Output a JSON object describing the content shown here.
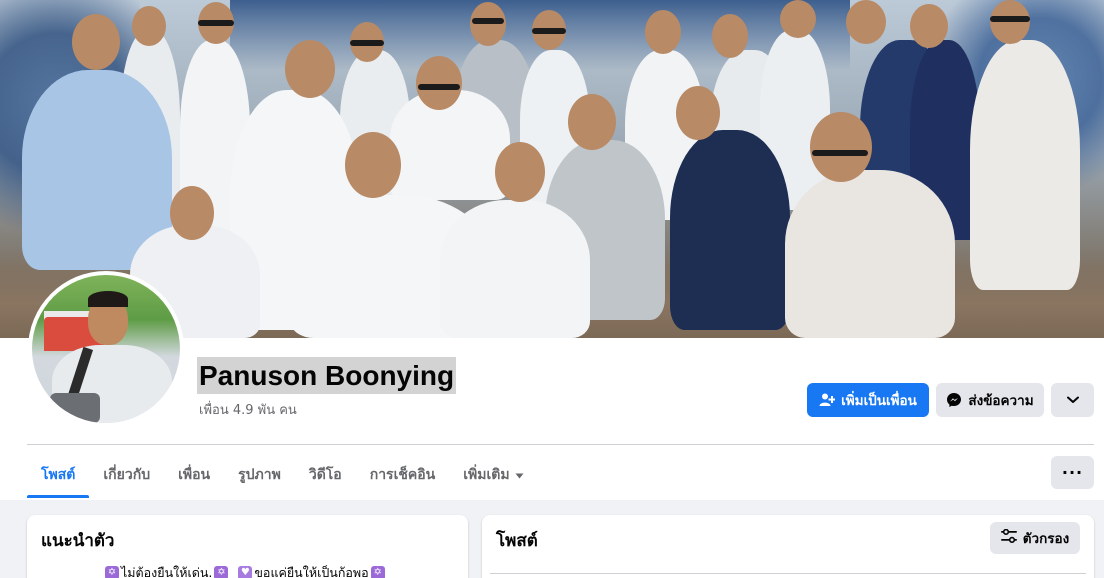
{
  "profile": {
    "name": "Panuson Boonying",
    "friends_count": "เพื่อน 4.9 พัน คน"
  },
  "actions": {
    "add_friend_label": "เพิ่มเป็นเพื่อน",
    "message_label": "ส่งข้อความ",
    "more_icon": "chevron-down-icon"
  },
  "tabs": [
    {
      "label": "โพสต์",
      "active": true
    },
    {
      "label": "เกี่ยวกับ",
      "active": false
    },
    {
      "label": "เพื่อน",
      "active": false
    },
    {
      "label": "รูปภาพ",
      "active": false
    },
    {
      "label": "วิดีโอ",
      "active": false
    },
    {
      "label": "การเช็คอิน",
      "active": false
    },
    {
      "label": "เพิ่มเติม",
      "active": false
    }
  ],
  "tab_overflow_label": "···",
  "intro": {
    "title": "แนะนำตัว",
    "bio_part1": "ไม่ต้องยืนให้เด่น.",
    "bio_part2": "ขอแค่ยืนให้เป็นก้อพอ"
  },
  "posts": {
    "title": "โพสต์",
    "filter_label": "ตัวกรอง"
  },
  "colors": {
    "accent": "#1877f2",
    "page_bg": "#f0f2f5",
    "button_gray": "#e4e6eb",
    "name_highlight": "#d3d3d3"
  }
}
